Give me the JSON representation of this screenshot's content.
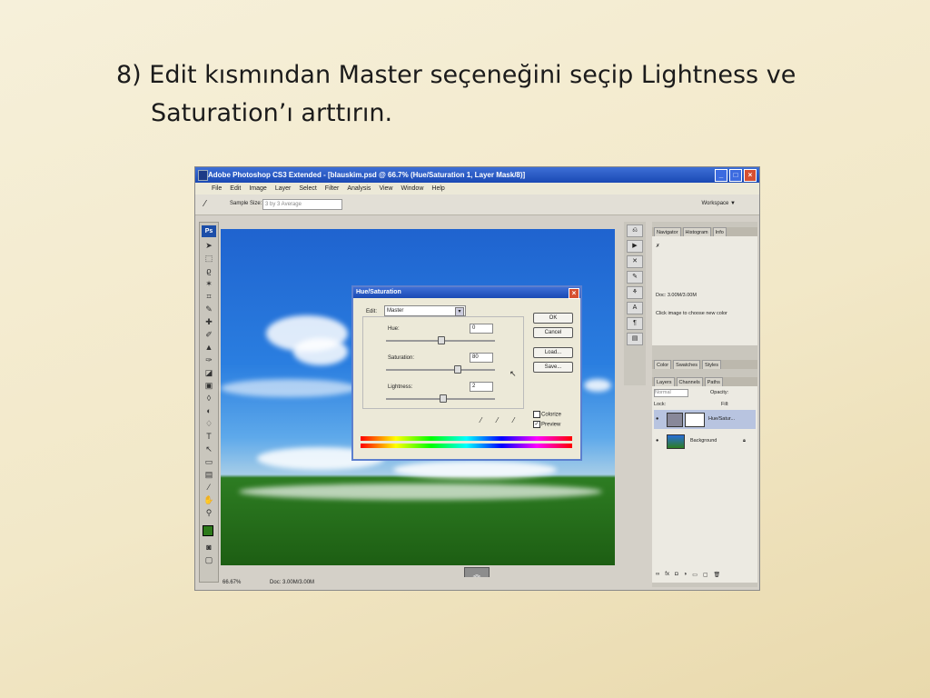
{
  "slide": {
    "line1": "8) Edit kısmından Master seçeneğini seçip Lightness ve",
    "line2": "Saturation’ı arttırın."
  },
  "app": {
    "title": "Adobe Photoshop CS3 Extended - [blauskim.psd @ 66.7% (Hue/Saturation 1, Layer Mask/8)]",
    "menu": [
      "File",
      "Edit",
      "Image",
      "Layer",
      "Select",
      "Filter",
      "Analysis",
      "View",
      "Window",
      "Help"
    ],
    "options": {
      "sample_label": "Sample Size:",
      "sample_value": "3 by 3 Average",
      "workspace": "Workspace ▼"
    },
    "status": {
      "zoom": "66.67%",
      "doc": "Doc: 3.00M/3.00M"
    }
  },
  "dialog": {
    "title": "Hue/Saturation",
    "edit_label": "Edit:",
    "edit_value": "Master",
    "hue_label": "Hue:",
    "hue_value": "0",
    "saturation_label": "Saturation:",
    "saturation_value": "80",
    "lightness_label": "Lightness:",
    "lightness_value": "2",
    "buttons": {
      "ok": "OK",
      "cancel": "Cancel",
      "load": "Load...",
      "save": "Save..."
    },
    "colorize_label": "Colorize",
    "preview_label": "Preview",
    "preview_checked": true
  },
  "panels": {
    "top_tabs": [
      "Navigator",
      "Histogram",
      "Info"
    ],
    "info_text": "Click image to choose new color",
    "info_doc": "Doc: 3.00M/3.00M",
    "mid_tabs": [
      "Color",
      "Swatches",
      "Styles"
    ],
    "layer_tabs": [
      "Layers",
      "Channels",
      "Paths"
    ],
    "blend_mode": "Normal",
    "opacity_label": "Opacity:",
    "fill_label": "Fill:",
    "lock_label": "Lock:",
    "layers": [
      {
        "name": "Hue/Satur..."
      },
      {
        "name": "Background"
      }
    ]
  }
}
